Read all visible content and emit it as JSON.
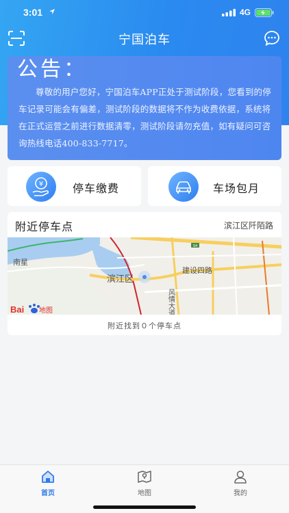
{
  "status_bar": {
    "time": "3:01",
    "network": "4G"
  },
  "nav": {
    "title": "宁国泊车"
  },
  "notice": {
    "title": "公告：",
    "body": "尊敬的用户您好，宁国泊车APP正处于测试阶段，您看到的停车记录可能会有偏差，测试阶段的数据将不作为收费依据，系统将在正式运营之前进行数据清零，测试阶段请勿充值，如有疑问可咨询热线电话400-833-7717。"
  },
  "actions": {
    "pay_label": "停车缴费",
    "monthly_label": "车场包月"
  },
  "nearby": {
    "title": "附近停车点",
    "location": "滨江区阡陌路",
    "count_text": "附近找到０个停车点",
    "map_labels": {
      "area": "滨江区",
      "road1": "建设四路",
      "road2": "风情大道",
      "place": "南星",
      "route": "S4",
      "brand": "Bai",
      "brand_suffix": "地图"
    }
  },
  "tabs": [
    {
      "label": "首页",
      "icon": "home-icon",
      "active": true
    },
    {
      "label": "地图",
      "icon": "map-icon",
      "active": false
    },
    {
      "label": "我的",
      "icon": "user-icon",
      "active": false
    }
  ],
  "colors": {
    "primary": "#2f7bea",
    "header": "#2a8af0",
    "notice": "#5b8fef"
  }
}
